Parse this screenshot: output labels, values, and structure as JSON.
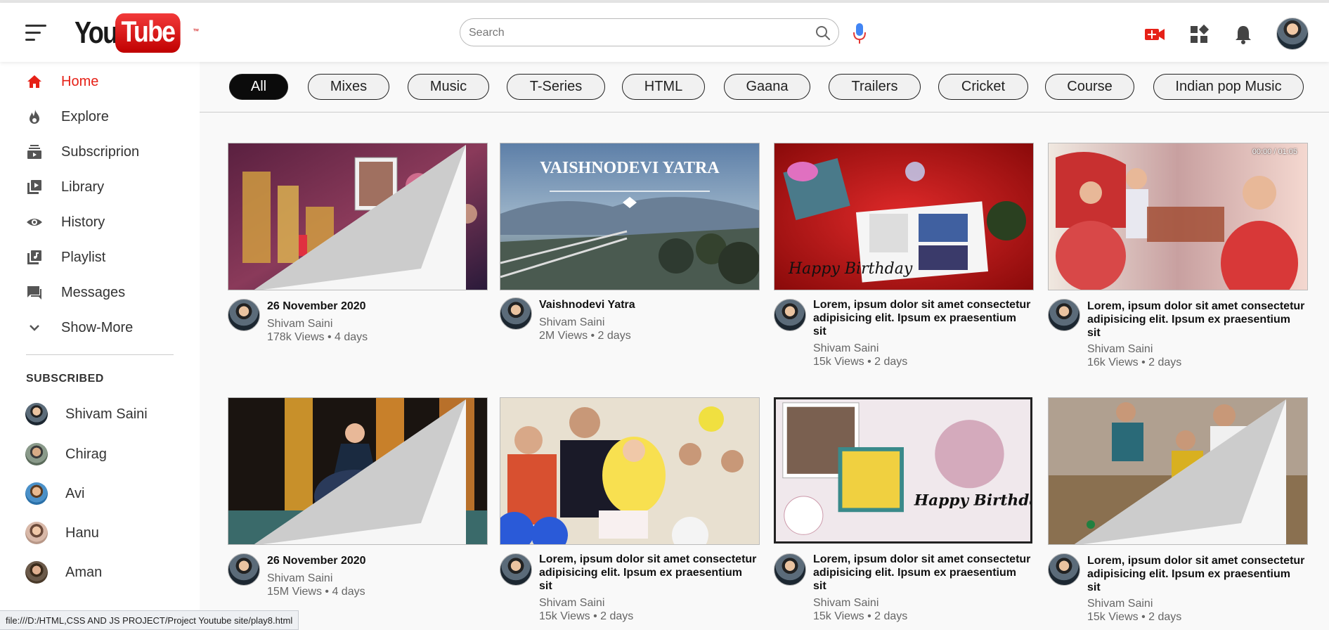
{
  "app": {
    "logo_you": "You",
    "logo_tube": "Tube",
    "logo_tm": "™"
  },
  "search": {
    "placeholder": "Search",
    "value": ""
  },
  "header_icons": [
    "create-video-icon",
    "apps-grid-icon",
    "notifications-bell-icon"
  ],
  "colors": {
    "accent": "#e62117",
    "active_chip": "#0b0b0b",
    "mic_blue": "#4285f4"
  },
  "sidebar": {
    "nav": [
      {
        "label": "Home",
        "icon": "home-icon",
        "active": true
      },
      {
        "label": "Explore",
        "icon": "flame-icon"
      },
      {
        "label": "Subscriprion",
        "icon": "subscriptions-icon"
      },
      {
        "label": "Library",
        "icon": "library-icon"
      },
      {
        "label": "History",
        "icon": "eye-icon"
      },
      {
        "label": "Playlist",
        "icon": "playlist-icon"
      },
      {
        "label": "Messages",
        "icon": "chat-icon"
      },
      {
        "label": "Show-More",
        "icon": "chevron-down-icon"
      }
    ],
    "subscribed_heading": "SUBSCRIBED",
    "subscriptions": [
      {
        "name": "Shivam Saini"
      },
      {
        "name": "Chirag"
      },
      {
        "name": "Avi"
      },
      {
        "name": "Hanu"
      },
      {
        "name": "Aman"
      }
    ]
  },
  "chips": [
    "All",
    "Mixes",
    "Music",
    "T-Series",
    "HTML",
    "Gaana",
    "Trailers",
    "Cricket",
    "Course",
    "Indian pop Music"
  ],
  "videos": [
    {
      "title": "26 November 2020",
      "channel": "Shivam Saini",
      "stats": "178k Views • 4 days",
      "thumb": "anniversary-decoration"
    },
    {
      "title": "Vaishnodevi Yatra",
      "channel": "Shivam Saini",
      "stats": "2M Views • 2 days",
      "thumb": "vaishnodevi-yatra",
      "overlay_text": "VAISHNODEVI YATRA"
    },
    {
      "title": "Lorem, ipsum dolor sit amet consectetur adipisicing elit. Ipsum ex praesentium sit",
      "channel": "Shivam Saini",
      "stats": "15k Views • 2 days",
      "thumb": "happy-birthday-red",
      "overlay_text": "Happy Birthday"
    },
    {
      "title": "Lorem, ipsum dolor sit amet consectetur adipisicing elit. Ipsum ex praesentium sit",
      "channel": "Shivam Saini",
      "stats": "16k Views • 2 days",
      "thumb": "wedding-couple",
      "timestamp": "00:00 / 01:05"
    },
    {
      "title": "26 November 2020",
      "channel": "Shivam Saini",
      "stats": "15M Views • 4 days",
      "thumb": "girl-sparkly-dress"
    },
    {
      "title": "Lorem, ipsum dolor sit amet consectetur adipisicing elit. Ipsum ex praesentium sit",
      "channel": "Shivam Saini",
      "stats": "15k Views • 2 days",
      "thumb": "birthday-party-balloons"
    },
    {
      "title": "Lorem, ipsum dolor sit amet consectetur adipisicing elit. Ipsum ex praesentium sit",
      "channel": "Shivam Saini",
      "stats": "15k Views • 2 days",
      "thumb": "birthday-collage",
      "overlay_text": "Happy Birthday Himani"
    },
    {
      "title": "Lorem, ipsum dolor sit amet consectetur adipisicing elit. Ipsum ex praesentium sit",
      "channel": "Shivam Saini",
      "stats": "15k Views • 2 days",
      "thumb": "kids-room-party"
    }
  ],
  "status_bar": {
    "url": "file:///D:/HTML,CSS AND JS  PROJECT/Project Youtube site/play8.html"
  }
}
